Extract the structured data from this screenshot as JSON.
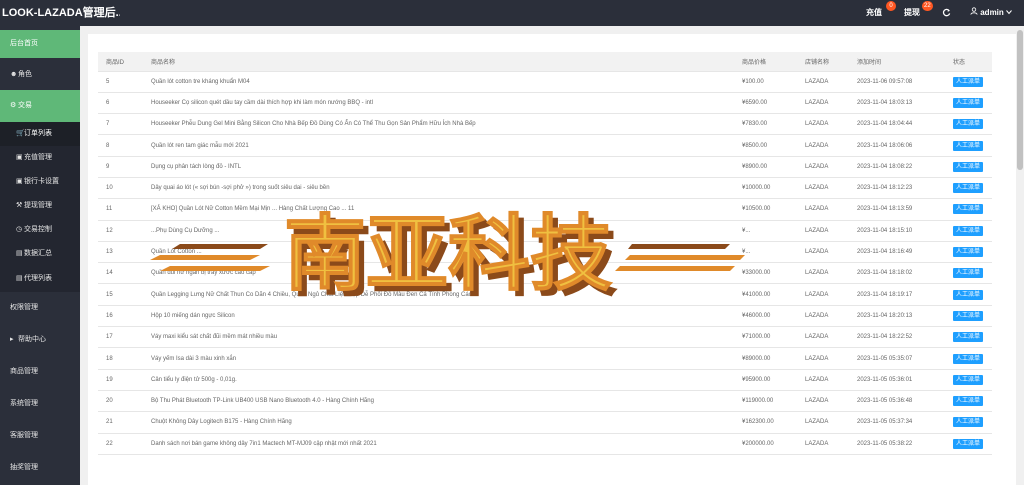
{
  "app": {
    "title": "LOOK-LAZADA管理后..."
  },
  "topbar": {
    "recharge_label": "充值",
    "recharge_badge": "0",
    "withdraw_label": "提现",
    "withdraw_badge": "22",
    "refresh_icon": "refresh-icon",
    "user_icon": "user-icon",
    "user_name": "admin",
    "user_dropdown_icon": "chevron-down-icon"
  },
  "sidebar": {
    "home": "后台首页",
    "role": "角色",
    "trade": "交易",
    "orders": "订单列表",
    "recharge_mgmt": "充值管理",
    "bankcard": "银行卡设置",
    "withdraw_mgmt": "提现管理",
    "trade_control": "交易控制",
    "data_summary": "数据汇总",
    "agent_list": "代理列表",
    "perm": "权限管理",
    "help": "帮助中心",
    "goods": "商品管理",
    "system": "系统管理",
    "service": "客服管理",
    "lottery": "抽奖管理"
  },
  "table": {
    "headers": [
      "商品ID",
      "商品名称",
      "商品价格",
      "店铺名称",
      "添加时间",
      "状态"
    ],
    "rows": [
      {
        "id": "5",
        "name": "Quần lót cotton tre kháng khuẩn M04",
        "price": "¥100.00",
        "store": "LAZADA",
        "time": "2023-11-06 09:57:08",
        "status": "人工派单"
      },
      {
        "id": "6",
        "name": "Houseeker Cọ silicon quét dầu tay cầm dài thích hợp khi làm món nướng BBQ - intl",
        "price": "¥6590.00",
        "store": "LAZADA",
        "time": "2023-11-04 18:03:13",
        "status": "人工派单"
      },
      {
        "id": "7",
        "name": "Houseeker Phễu Dung Gel Mini Bằng Silicon Cho Nhà Bếp Đồ Dùng Có Ẩn Có Thể Thu Gọn Sản Phẩm Hữu Ích Nhà Bếp",
        "price": "¥7830.00",
        "store": "LAZADA",
        "time": "2023-11-04 18:04:44",
        "status": "人工派单"
      },
      {
        "id": "8",
        "name": "Quần lót ren tam giác mẫu mới 2021",
        "price": "¥8500.00",
        "store": "LAZADA",
        "time": "2023-11-04 18:06:06",
        "status": "人工派单"
      },
      {
        "id": "9",
        "name": "Dụng cụ phân tách lòng đỏ - INTL",
        "price": "¥8900.00",
        "store": "LAZADA",
        "time": "2023-11-04 18:08:22",
        "status": "人工派单"
      },
      {
        "id": "10",
        "name": "Dây quai áo lót (« sợi bún -sợi phở ») trong suốt siêu dai - siêu bền",
        "price": "¥10000.00",
        "store": "LAZADA",
        "time": "2023-11-04 18:12:23",
        "status": "人工派单"
      },
      {
        "id": "11",
        "name": "[XẢ KHO] Quần Lót Nữ Cotton Mềm Mại Mịn ... Hàng Chất Lượng Cao ... 11",
        "price": "¥10500.00",
        "store": "LAZADA",
        "time": "2023-11-04 18:13:59",
        "status": "人工派单"
      },
      {
        "id": "12",
        "name": "...Phụ Dùng Cụ Dưỡng ...",
        "price": "¥...",
        "store": "LAZADA",
        "time": "2023-11-04 18:15:10",
        "status": "人工派单"
      },
      {
        "id": "13",
        "name": "Quần Lót Cotton ...",
        "price": "¥...",
        "store": "LAZADA",
        "time": "2023-11-04 18:16:49",
        "status": "人工派单"
      },
      {
        "id": "14",
        "name": "Quần đùi nữ ngắn bị trầy xước cao cấp",
        "price": "¥33000.00",
        "store": "LAZADA",
        "time": "2023-11-04 18:18:02",
        "status": "人工派单"
      },
      {
        "id": "15",
        "name": "Quần Legging Lưng Nữ Chất Thun Co Dãn 4 Chiều, Quần Ngủ Chất Liệu Đẹp Dễ Phối Đồ Màu Đen Cá Tính Phong Cách",
        "price": "¥41000.00",
        "store": "LAZADA",
        "time": "2023-11-04 18:19:17",
        "status": "人工派单"
      },
      {
        "id": "16",
        "name": "Hộp 10 miếng dán ngực Silicon",
        "price": "¥46000.00",
        "store": "LAZADA",
        "time": "2023-11-04 18:20:13",
        "status": "人工派单"
      },
      {
        "id": "17",
        "name": "Váy maxi kiểu sát chất đũi mềm mát nhiều màu",
        "price": "¥71000.00",
        "store": "LAZADA",
        "time": "2023-11-04 18:22:52",
        "status": "人工派单"
      },
      {
        "id": "18",
        "name": "Váy yếm Isa dài 3 màu xinh xắn",
        "price": "¥89000.00",
        "store": "LAZADA",
        "time": "2023-11-05 05:35:07",
        "status": "人工派单"
      },
      {
        "id": "19",
        "name": "Cân tiểu ly điện tử 500g - 0,01g.",
        "price": "¥95900.00",
        "store": "LAZADA",
        "time": "2023-11-05 05:36:01",
        "status": "人工派单"
      },
      {
        "id": "20",
        "name": "Bộ Thu Phát Bluetooth TP-Link UB400 USB Nano Bluetooth 4.0 - Hàng Chính Hãng",
        "price": "¥119000.00",
        "store": "LAZADA",
        "time": "2023-11-05 05:36:48",
        "status": "人工派单"
      },
      {
        "id": "21",
        "name": "Chuột Không Dây Logitech B175 - Hàng Chính Hãng",
        "price": "¥162300.00",
        "store": "LAZADA",
        "time": "2023-11-05 05:37:34",
        "status": "人工派单"
      },
      {
        "id": "22",
        "name": "Danh sách nơi bán game không dây 7in1 Mactech MT-MJ09 cập nhật mới nhất 2021",
        "price": "¥200000.00",
        "store": "LAZADA",
        "time": "2023-11-05 05:38:22",
        "status": "人工派单"
      }
    ]
  },
  "watermark": {
    "text": "南亚科技",
    "colors": {
      "fill": "#f0c040",
      "shadow": "#8b4a1a",
      "edge": "#e08a2a"
    }
  }
}
